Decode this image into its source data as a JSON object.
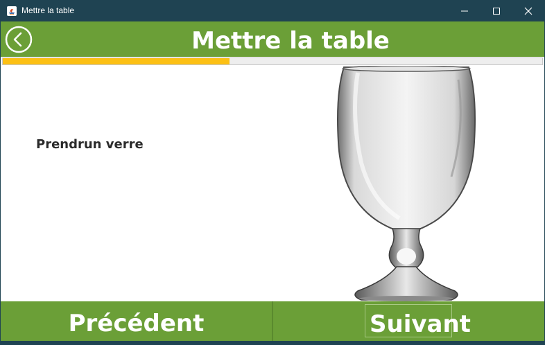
{
  "window": {
    "title": "Mettre la table",
    "icons": [
      "java-app-icon",
      "minimize-icon",
      "maximize-icon",
      "close-icon"
    ]
  },
  "header": {
    "title": "Mettre la table",
    "back_icon": "back-arrow-circle-icon"
  },
  "progress": {
    "fraction": 0.42,
    "fill_color": "#fcc014"
  },
  "content": {
    "instruction": "Prendrun verre",
    "image": "glass-image"
  },
  "footer": {
    "previous_label": "Précédent",
    "next_label": "Suivant"
  },
  "colors": {
    "titlebar": "#1f4352",
    "accent_green": "#6b9f37",
    "progress_yellow": "#fcc014"
  }
}
